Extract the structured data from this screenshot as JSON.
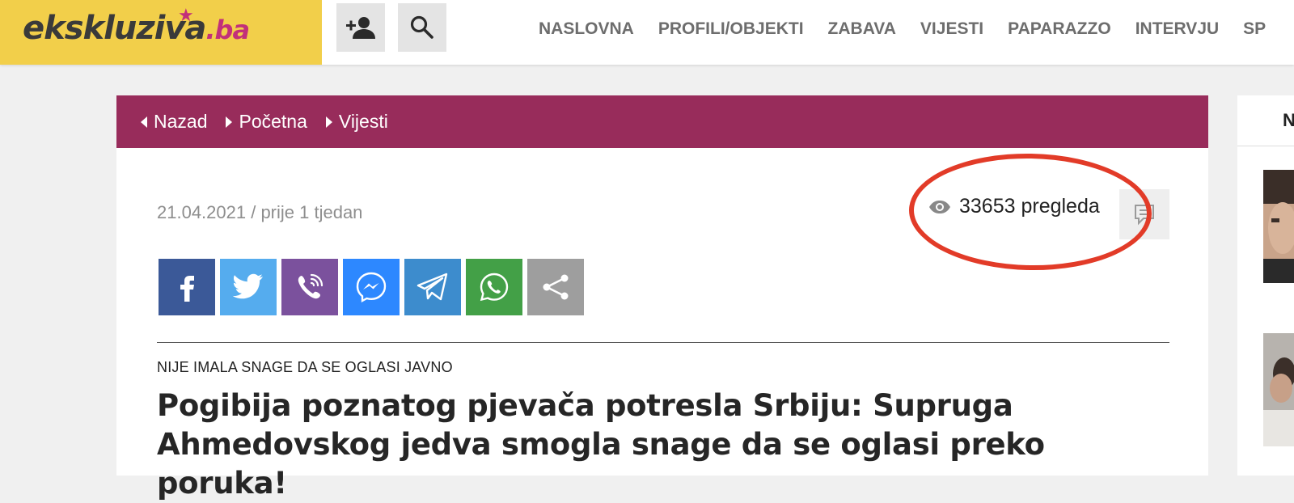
{
  "header": {
    "logo": {
      "main": "ekskluziva",
      "tld": ".ba"
    },
    "nav": [
      "NASLOVNA",
      "PROFILI/OBJEKTI",
      "ZABAVA",
      "VIJESTI",
      "PAPARAZZO",
      "INTERVJU",
      "SP"
    ]
  },
  "breadcrumb": {
    "back": "Nazad",
    "home": "Početna",
    "section": "Vijesti"
  },
  "article": {
    "date": "21.04.2021 / prije 1 tjedan",
    "views": "33653 pregleda",
    "kicker": "NIJE IMALA SNAGE DA SE OGLASI JAVNO",
    "headline": "Pogibija poznatog pjevača potresla Srbiju: Supruga Ahmedovskog jedva smogla snage da se oglasi preko poruka!"
  },
  "share": [
    {
      "icon": "facebook-icon",
      "color": "#3b5998"
    },
    {
      "icon": "twitter-icon",
      "color": "#55acee"
    },
    {
      "icon": "viber-icon",
      "color": "#7b519d"
    },
    {
      "icon": "messenger-icon",
      "color": "#2d88ff"
    },
    {
      "icon": "telegram-icon",
      "color": "#3d8ccd"
    },
    {
      "icon": "whatsapp-icon",
      "color": "#43a047"
    },
    {
      "icon": "share-icon",
      "color": "#9e9e9e"
    }
  ],
  "sidebar": {
    "tab": "N"
  },
  "colors": {
    "brand_yellow": "#f2cf4a",
    "brand_purple": "#982c5b",
    "annotation_red": "#e23b28"
  }
}
